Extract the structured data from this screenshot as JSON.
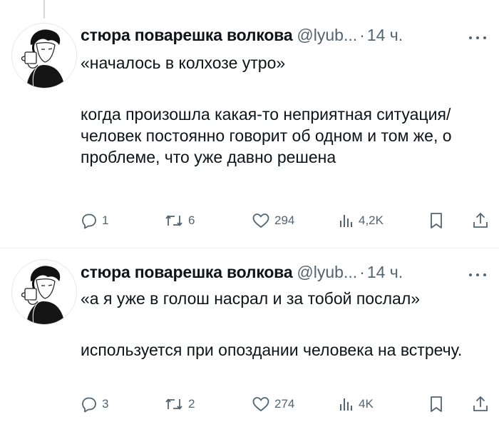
{
  "tweets": [
    {
      "author_name": "стюра поварешка волкова",
      "handle": "@lyub...",
      "separator": "·",
      "time": "14 ч.",
      "quote": "«началось в колхозе утро»",
      "text": "когда произошла какая-то неприятная ситуация/человек постоянно говорит об одном и том же, о проблеме, что уже давно решена",
      "replies": "1",
      "retweets": "6",
      "likes": "294",
      "views": "4,2K"
    },
    {
      "author_name": "стюра поварешка волкова",
      "handle": "@lyub...",
      "separator": "·",
      "time": "14 ч.",
      "quote": "«а я уже в голош насрал и за тобой послал»",
      "text": "используется при опоздании человека на встречу.",
      "replies": "3",
      "retweets": "2",
      "likes": "274",
      "views": "4K"
    }
  ],
  "icons": {
    "reply": "speech-bubble-icon",
    "retweet": "retweet-arrows-icon",
    "like": "heart-icon",
    "views": "bar-chart-icon",
    "bookmark": "bookmark-icon",
    "share": "share-upload-icon",
    "more": "three-dots-icon"
  },
  "colors": {
    "text_primary": "#0f1419",
    "text_secondary": "#536471",
    "divider": "#eff3f4",
    "thread_line": "#cfd9de"
  }
}
